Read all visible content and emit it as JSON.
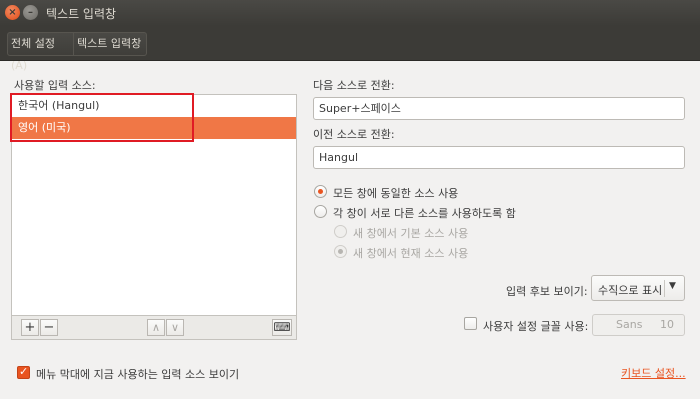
{
  "window": {
    "title": "텍스트 입력창"
  },
  "toolbar": {
    "global_settings": "전체 설정(A)",
    "text_entry": "텍스트 입력창"
  },
  "sources": {
    "label": "사용할 입력 소스:",
    "items": [
      {
        "label": "한국어 (Hangul)",
        "selected": false
      },
      {
        "label": "영어 (미국)",
        "selected": true
      }
    ],
    "add_label": "+",
    "remove_label": "−",
    "up_label": "∧",
    "down_label": "∨",
    "keyboard_label": "⌨"
  },
  "switch_next": {
    "label": "다음 소스로 전환:",
    "value": "Super+스페이스"
  },
  "switch_prev": {
    "label": "이전 소스로 전환:",
    "value": "Hangul"
  },
  "mode": {
    "same_for_all": "모든 창에 동일한 소스 사용",
    "per_window": "각 창이 서로 다른 소스를 사용하도록 함",
    "new_window_default": "새 창에서 기본 소스 사용",
    "new_window_current": "새 창에서 현재 소스 사용"
  },
  "candidates": {
    "label": "입력 후보 보이기:",
    "selected": "수직으로 표시"
  },
  "custom_font": {
    "label": "사용자 설정 글꼴 사용:",
    "font_name": "Sans",
    "font_size": "10"
  },
  "footer": {
    "show_menu_label": "메뉴 막대에 지금 사용하는 입력 소스 보이기",
    "keyboard_settings_link": "키보드 설정..."
  },
  "colors": {
    "accent": "#e95420",
    "selection": "#f07746",
    "highlight_box": "#e01b24"
  }
}
